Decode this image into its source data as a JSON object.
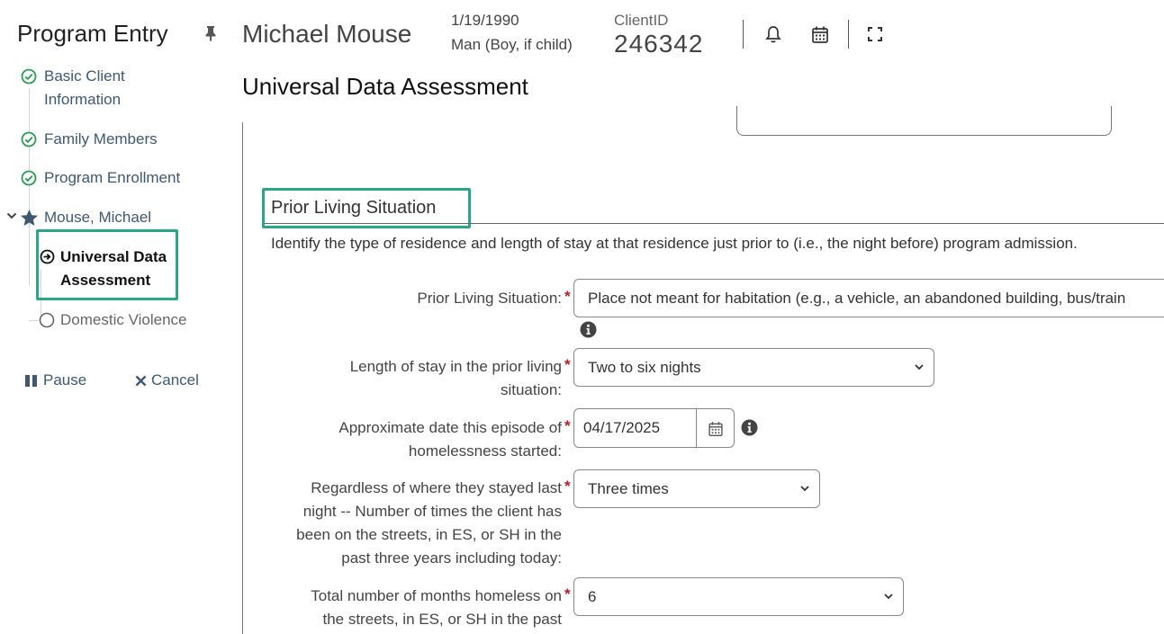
{
  "sidebar": {
    "title": "Program Entry",
    "steps": [
      {
        "line1": "Basic Client",
        "line2": "Information"
      },
      {
        "line1": "Family Members"
      },
      {
        "line1": "Program Enrollment"
      },
      {
        "line1": "Mouse, Michael"
      }
    ],
    "active_step": {
      "line1": "Universal Data",
      "line2": "Assessment"
    },
    "next_step": "Domestic Violence",
    "pause_label": "Pause",
    "cancel_label": "Cancel"
  },
  "header": {
    "client_name": "Michael Mouse",
    "dob": "1/19/1990",
    "gender": "Man (Boy, if child)",
    "client_id_label": "ClientID",
    "client_id": "246342"
  },
  "page": {
    "title": "Universal Data Assessment",
    "section_title": "Prior Living Situation",
    "section_desc": "Identify the type of residence and length of stay at that residence just prior to (i.e., the night before) program admission."
  },
  "fields": {
    "prior_living": {
      "label": "Prior Living Situation:",
      "value": "Place not meant for habitation (e.g., a vehicle, an abandoned building, bus/train"
    },
    "length_of_stay": {
      "label_line1": "Length of stay in the prior living",
      "label_line2": "situation:",
      "value": "Two to six nights"
    },
    "approx_date": {
      "label_line1": "Approximate date this episode of",
      "label_line2": "homelessness started:",
      "value": "04/17/2025"
    },
    "times_homeless": {
      "label_line1": "Regardless of where they stayed last",
      "label_line2": "night -- Number of times the client has",
      "label_line3": "been on the streets, in ES, or SH in the",
      "label_line4": "past three years including today:",
      "value": "Three times"
    },
    "months_homeless": {
      "label_line1": "Total number of months homeless on",
      "label_line2": "the streets, in ES, or SH in the past",
      "value": "6"
    }
  },
  "required_marker": "*",
  "colors": {
    "highlight": "#2aa786",
    "sidebar_text": "#3e5870",
    "required": "#b3202a"
  }
}
